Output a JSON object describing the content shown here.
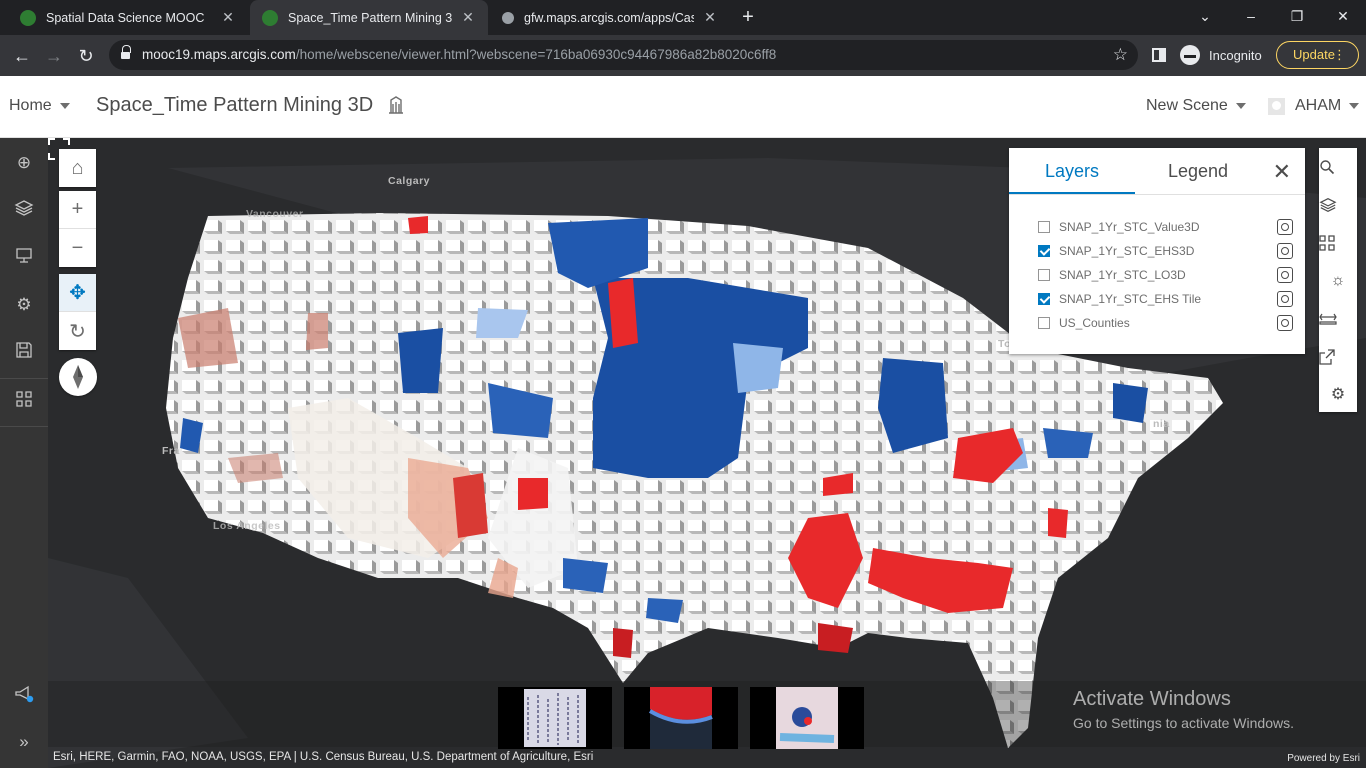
{
  "browser": {
    "tabs": [
      {
        "title": "Spatial Data Science MOOC",
        "active": false
      },
      {
        "title": "Space_Time Pattern Mining 3D",
        "active": true
      },
      {
        "title": "gfw.maps.arcgis.com/apps/Casc",
        "active": false
      }
    ],
    "url_host": "mooc19.maps.arcgis.com",
    "url_path": "/home/webscene/viewer.html?webscene=716ba06930c94467986a82b8020c6ff8",
    "incognito_label": "Incognito",
    "update_label": "Update",
    "window_controls": {
      "minimize": "–",
      "restore": "❐",
      "close": "✕",
      "tab_menu": "⌄"
    }
  },
  "header": {
    "home_label": "Home",
    "scene_title": "Space_Time Pattern Mining 3D",
    "new_scene_label": "New Scene",
    "user_label": "AHAM"
  },
  "layers_panel": {
    "tab_layers": "Layers",
    "tab_legend": "Legend",
    "active_tab": "Layers",
    "layers": [
      {
        "name": "SNAP_1Yr_STC_Value3D",
        "checked": false
      },
      {
        "name": "SNAP_1Yr_STC_EHS3D",
        "checked": true
      },
      {
        "name": "SNAP_1Yr_STC_LO3D",
        "checked": false
      },
      {
        "name": "SNAP_1Yr_STC_EHS Tile",
        "checked": true
      },
      {
        "name": "US_Counties",
        "checked": false
      }
    ]
  },
  "map": {
    "city_labels": [
      "Calgary",
      "Vancouver",
      "Fra",
      "Los Angeles",
      "Tor",
      "nia"
    ],
    "attribution": "Esri, HERE, Garmin, FAO, NOAA, USGS, EPA | U.S. Census Bureau, U.S. Department of Agriculture, Esri",
    "powered_by": "Powered by Esri",
    "colors": {
      "hot": "#e8292b",
      "cold": "#1a4fa3",
      "neutral": "#f2f2f2",
      "basemap": "#2a2b2d"
    }
  },
  "watermark": {
    "line1": "Activate Windows",
    "line2": "Go to Settings to activate Windows."
  }
}
